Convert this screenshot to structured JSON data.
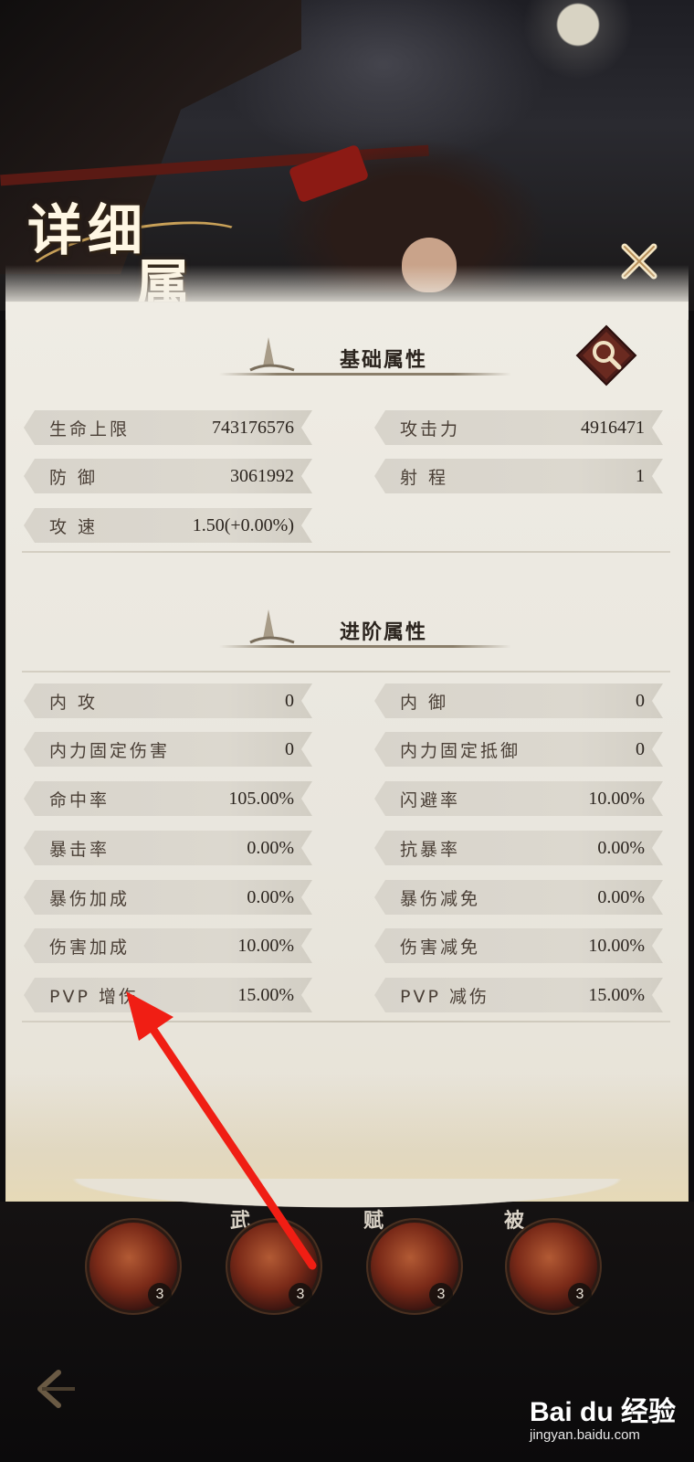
{
  "title": {
    "line1": "详细",
    "line2": "属性"
  },
  "sections": {
    "basic": {
      "title": "基础属性"
    },
    "advanced": {
      "title": "进阶属性"
    }
  },
  "basic_stats": [
    {
      "label": "生命上限",
      "value": "743176576"
    },
    {
      "label": "攻击力",
      "value": "4916471"
    },
    {
      "label": "防 御",
      "value": "3061992"
    },
    {
      "label": "射 程",
      "value": "1"
    },
    {
      "label": "攻 速",
      "value": "1.50(+0.00%)"
    }
  ],
  "advanced_stats": [
    {
      "label": "内 攻",
      "value": "0"
    },
    {
      "label": "内 御",
      "value": "0"
    },
    {
      "label": "内力固定伤害",
      "value": "0"
    },
    {
      "label": "内力固定抵御",
      "value": "0"
    },
    {
      "label": "命中率",
      "value": "105.00%"
    },
    {
      "label": "闪避率",
      "value": "10.00%"
    },
    {
      "label": "暴击率",
      "value": "0.00%"
    },
    {
      "label": "抗暴率",
      "value": "0.00%"
    },
    {
      "label": "暴伤加成",
      "value": "0.00%"
    },
    {
      "label": "暴伤减免",
      "value": "0.00%"
    },
    {
      "label": "伤害加成",
      "value": "10.00%"
    },
    {
      "label": "伤害减免",
      "value": "10.00%"
    },
    {
      "label": "PVP 增伤",
      "value": "15.00%"
    },
    {
      "label": "PVP 减伤",
      "value": "15.00%"
    }
  ],
  "skills": [
    {
      "tag": "",
      "count": "3"
    },
    {
      "tag": "武",
      "count": "3"
    },
    {
      "tag": "赋",
      "count": "3"
    },
    {
      "tag": "被",
      "count": "3"
    }
  ],
  "watermark": {
    "main": "Bai du 经验",
    "url": "jingyan.baidu.com"
  },
  "icons": {
    "close": "close-icon",
    "search": "search-icon",
    "back": "back-arrow-icon",
    "brush": "brush-icon"
  },
  "colors": {
    "accent_gold": "#c8a058",
    "panel": "#efece4",
    "annotation_red": "#f01e14"
  }
}
